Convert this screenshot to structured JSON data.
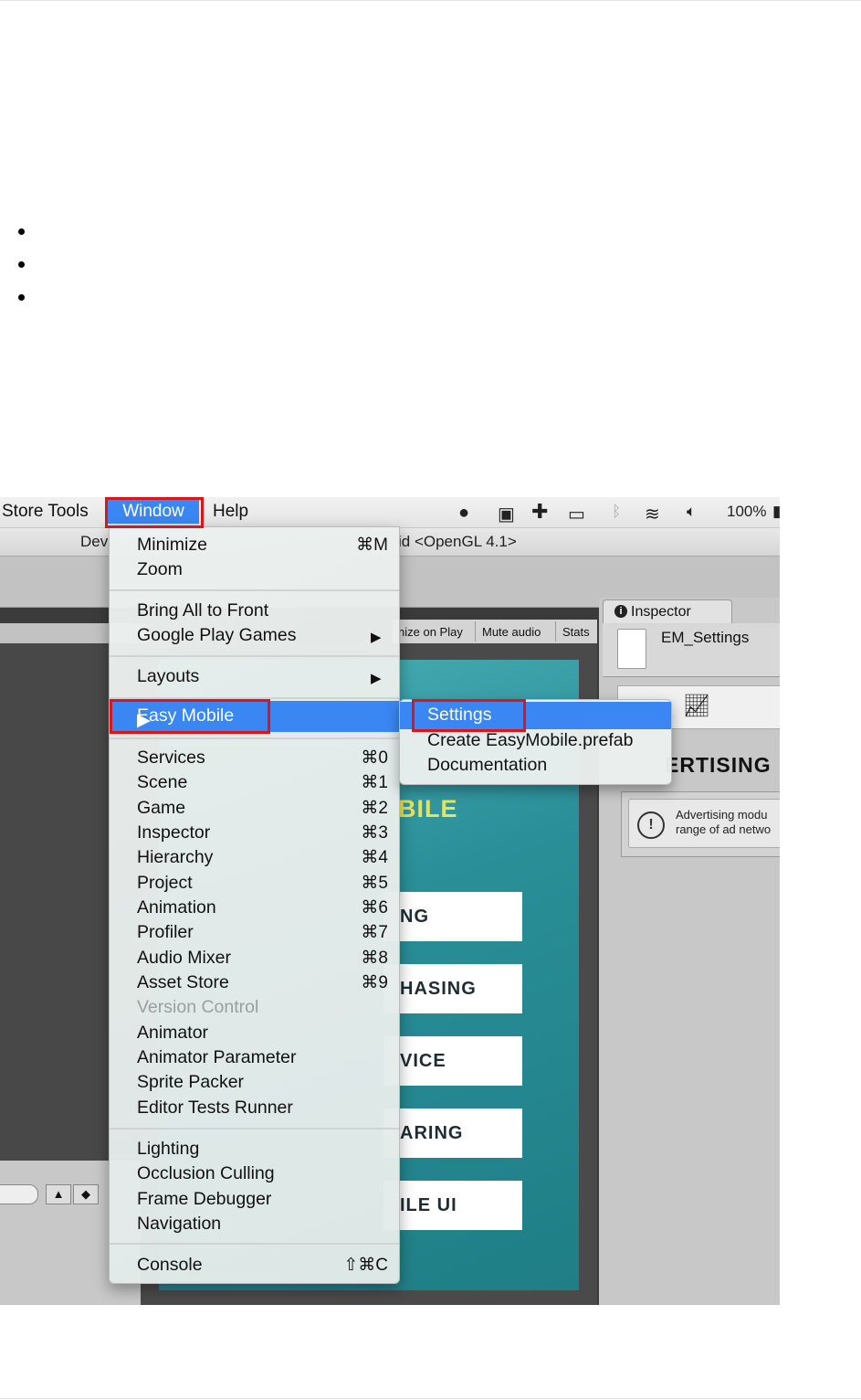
{
  "menubar": {
    "items": [
      "Store Tools",
      "Window",
      "Help"
    ],
    "battery": "100%"
  },
  "titlebar": {
    "left_fragment": "Dev",
    "right_fragment": "id <OpenGL 4.1>"
  },
  "window_menu": {
    "minimize": "Minimize",
    "minimize_shortcut": "⌘M",
    "zoom": "Zoom",
    "bring_all": "Bring All to Front",
    "google_play_games": "Google Play Games",
    "layouts": "Layouts",
    "easy_mobile": "Easy Mobile",
    "windows": [
      {
        "label": "Services",
        "shortcut": "⌘0"
      },
      {
        "label": "Scene",
        "shortcut": "⌘1"
      },
      {
        "label": "Game",
        "shortcut": "⌘2"
      },
      {
        "label": "Inspector",
        "shortcut": "⌘3"
      },
      {
        "label": "Hierarchy",
        "shortcut": "⌘4"
      },
      {
        "label": "Project",
        "shortcut": "⌘5"
      },
      {
        "label": "Animation",
        "shortcut": "⌘6"
      },
      {
        "label": "Profiler",
        "shortcut": "⌘7"
      },
      {
        "label": "Audio Mixer",
        "shortcut": "⌘8"
      },
      {
        "label": "Asset Store",
        "shortcut": "⌘9"
      }
    ],
    "version_control": "Version Control",
    "tools": [
      "Animator",
      "Animator Parameter",
      "Sprite Packer",
      "Editor Tests Runner"
    ],
    "rendering": [
      "Lighting",
      "Occlusion Culling",
      "Frame Debugger",
      "Navigation"
    ],
    "console": "Console",
    "console_shortcut": "⇧⌘C"
  },
  "submenu": {
    "settings": "Settings",
    "create_prefab": "Create EasyMobile.prefab",
    "documentation": "Documentation"
  },
  "game_view": {
    "toolbar": [
      "nize on Play",
      "Mute audio",
      "Stats"
    ],
    "logo_fragment": "BILE",
    "buttons": [
      "NG",
      "HASING",
      "VICE",
      "ARING",
      "ILE UI"
    ]
  },
  "inspector": {
    "tab": "Inspector",
    "asset_name": "EM_Settings",
    "section_title": "ERTISING",
    "info_line1": "Advertising modu",
    "info_line2": "range of ad netwo"
  },
  "colors": {
    "menu_highlight": "#3a86f2",
    "annotation_red": "#d8161c",
    "game_teal": "#2a8f98",
    "logo_yellow": "#e8e35a"
  }
}
